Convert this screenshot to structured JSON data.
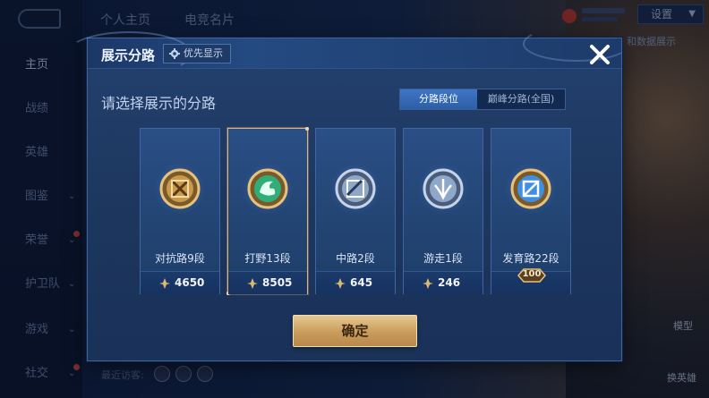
{
  "background": {
    "top_tabs": [
      "个人主页",
      "电竞名片"
    ],
    "settings_label": "设置",
    "data_show_text": "和数据展示",
    "side_nav": [
      {
        "label": "主页",
        "has_chevron": false,
        "has_dot": false
      },
      {
        "label": "战绩",
        "has_chevron": false,
        "has_dot": false
      },
      {
        "label": "英雄",
        "has_chevron": false,
        "has_dot": false
      },
      {
        "label": "图鉴",
        "has_chevron": true,
        "has_dot": false
      },
      {
        "label": "荣誉",
        "has_chevron": true,
        "has_dot": true
      },
      {
        "label": "护卫队",
        "has_chevron": true,
        "has_dot": false
      },
      {
        "label": "游戏",
        "has_chevron": true,
        "has_dot": false
      },
      {
        "label": "社交",
        "has_chevron": true,
        "has_dot": true
      }
    ],
    "recent_visitors_label": "最近访客:",
    "right_bottom": {
      "model_label": "模型",
      "switch_hero_label": "换英雄"
    }
  },
  "dialog": {
    "title": "展示分路",
    "priority_button_label": "优先显示",
    "select_prompt": "请选择展示的分路",
    "toggle": [
      {
        "label": "分路段位",
        "active": true
      },
      {
        "label": "巅峰分路(全国)",
        "active": false
      }
    ],
    "cards": [
      {
        "label": "对抗路9段",
        "value": "4650",
        "selected": false,
        "badge": null,
        "emblem": "clash-lane-emblem-icon",
        "emblem_color": "#c99a4a"
      },
      {
        "label": "打野13段",
        "value": "8505",
        "selected": true,
        "badge": null,
        "emblem": "jungle-emblem-icon",
        "emblem_color": "#2fae7a"
      },
      {
        "label": "中路2段",
        "value": "645",
        "selected": false,
        "badge": null,
        "emblem": "mid-lane-emblem-icon",
        "emblem_color": "#8fa7c8"
      },
      {
        "label": "游走1段",
        "value": "246",
        "selected": false,
        "badge": null,
        "emblem": "roam-emblem-icon",
        "emblem_color": "#8fa7c8"
      },
      {
        "label": "发育路22段",
        "value": null,
        "selected": false,
        "badge": "100",
        "emblem": "farm-lane-emblem-icon",
        "emblem_color": "#3f8fe0"
      }
    ],
    "confirm_label": "确定"
  },
  "colors": {
    "accent_gold": "#e0b479",
    "toggle_active": "#3f76c4",
    "dialog_bg": "#1d375f"
  }
}
